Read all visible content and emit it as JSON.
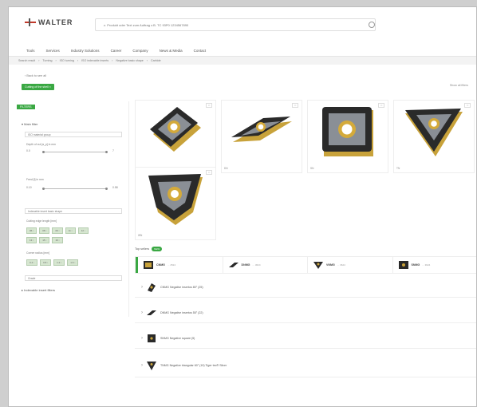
{
  "header": {
    "logo_text": "WALTER",
    "search_placeholder": "z. Produkt oder Text zum Auftrag z.B. TC 93P0 1234567890"
  },
  "nav": [
    "Tools",
    "Services",
    "Industry Solutions",
    "Career",
    "Company",
    "News & Media",
    "Contact"
  ],
  "breadcrumb": [
    "Search result",
    "Turning",
    "ISO turning",
    "ISO indexable inserts",
    "Negative basic shape",
    "Carbide"
  ],
  "back_link": "‹ Back to see all",
  "active_filter": "Cutting of the shell ×",
  "show_all": "Show all filters",
  "sidebar": {
    "filters_tag": "FILTERS",
    "main_filter_label": "▾ Main filter",
    "material_group": "ISO material group",
    "depth_label": "Depth of cut [a_p] in mm",
    "depth_min": "0.0",
    "depth_max": "7",
    "feed_label": "Feed [f] in mm",
    "feed_min": "0.10",
    "feed_max": "0.58",
    "basic_shape": "Indexable insert basic shape",
    "edge_length_label": "Cutting edge length [mm]",
    "edge_tags_row1": [
      "06 ▫",
      "08 ▫",
      "09 ▫",
      "11 ▫",
      "12 ▫"
    ],
    "edge_tags_row2": [
      "13 ▫",
      "15 ▫",
      "16 ▫"
    ],
    "radius_label": "Corner radius [mm]",
    "radius_tags": [
      "0.4 ▫",
      "0.8 ▫",
      "1.2 ▫",
      "1.6 ▫"
    ],
    "grade_select": "Grade",
    "more_filters": "▸ Indexable insert filters"
  },
  "products": [
    {
      "label": "CN",
      "badge": "□"
    },
    {
      "label": "DN",
      "badge": "□"
    },
    {
      "label": "SN",
      "badge": "□"
    },
    {
      "label": "TN",
      "badge": "□"
    },
    {
      "label": "WN",
      "badge": "□"
    }
  ],
  "top_sellers": {
    "label": "Top sellers",
    "count": "NEW"
  },
  "tabs": [
    {
      "name": "CNMG",
      "sub": "... 2524"
    },
    {
      "name": "DNMG",
      "sub": "... 3624"
    },
    {
      "name": "VNMG",
      "sub": "... 3624"
    },
    {
      "name": "SNMG",
      "sub": "... 3624"
    }
  ],
  "rows": [
    "CNMG Negative insertos 80° (25)",
    "DNMG Negative insertos 55° (22)",
    "SNMG Negative square (5)",
    "TNMG Negative triangular 60° (19) Tiger·tec® Silver"
  ],
  "colors": {
    "accent": "#3aa843",
    "gold": "#c8a23a",
    "insert": "#2a2a2a"
  }
}
